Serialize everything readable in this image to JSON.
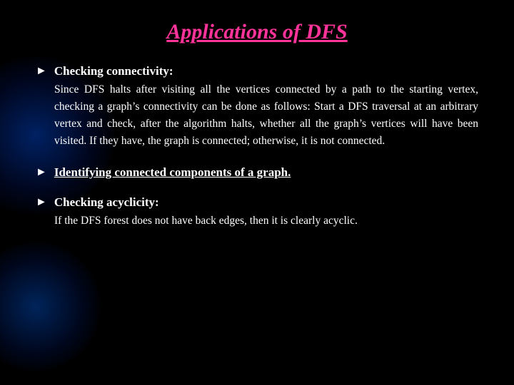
{
  "title": "Applications of DFS",
  "sections": [
    {
      "id": "connectivity",
      "header_label": "Checking connectivity:",
      "header_underlined": false,
      "body": "Since DFS halts after visiting all the vertices connected by a path to the starting vertex, checking a graph’s connectivity can be done as follows: Start a DFS traversal at an arbitrary vertex and check, after the algorithm halts, whether all the graph’s vertices will have been visited. If they have, the graph is connected; otherwise, it is not connected."
    },
    {
      "id": "components",
      "header_label": "Identifying  connected components of a graph.",
      "header_underlined": true,
      "body": null
    },
    {
      "id": "acyclicity",
      "header_label": "Checking acyclicity:",
      "header_underlined": false,
      "body": "If the DFS forest does not have back edges, then it is clearly acyclic."
    }
  ],
  "bullet_symbol": "►"
}
